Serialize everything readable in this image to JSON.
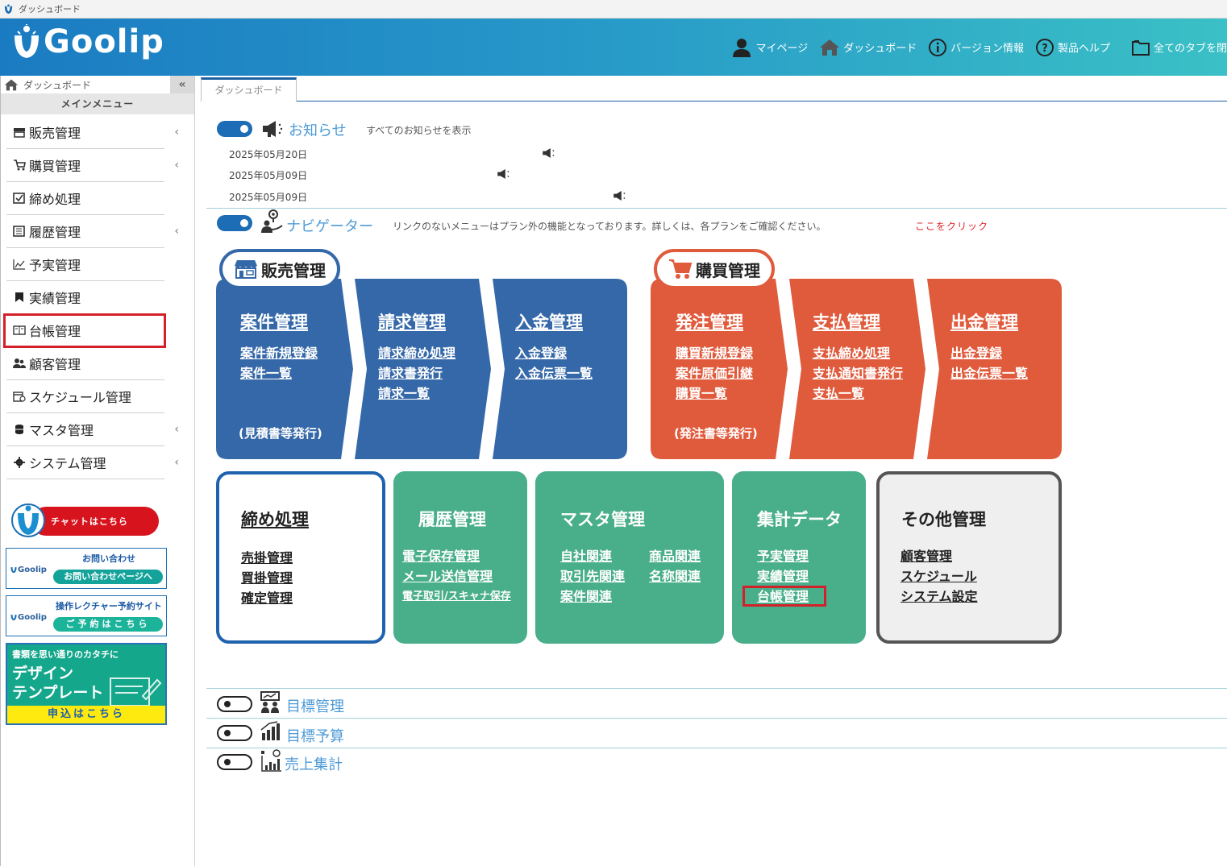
{
  "window": {
    "title": "ダッシュボード"
  },
  "header": {
    "logo_text": "Goolip",
    "nav": {
      "mypage": "マイページ",
      "dashboard": "ダッシュボード",
      "version": "バージョン情報",
      "help": "製品ヘルプ",
      "close_all": "全てのタブを閉"
    }
  },
  "sidebar": {
    "top_label": "ダッシュボード",
    "collapse_label": "«",
    "main_menu": "メインメニュー",
    "items": [
      {
        "label": "販売管理"
      },
      {
        "label": "購買管理"
      },
      {
        "label": "締め処理"
      },
      {
        "label": "履歴管理"
      },
      {
        "label": "予実管理"
      },
      {
        "label": "実績管理"
      },
      {
        "label": "台帳管理"
      },
      {
        "label": "顧客管理"
      },
      {
        "label": "スケジュール管理"
      },
      {
        "label": "マスタ管理"
      },
      {
        "label": "システム管理"
      }
    ],
    "chevron": "‹",
    "chat_label": "チャットはこちら",
    "inquiry": {
      "title": "お問い合わせ",
      "button": "お問い合わせページへ",
      "brand": "Goolip"
    },
    "lecture": {
      "title": "操作レクチャー予約サイト",
      "button": "ご予約はこちら",
      "brand": "Goolip"
    },
    "template": {
      "small": "書類を思い通りのカタチに",
      "line1": "デザイン",
      "line2": "テンプレート",
      "apply": "申込はこちら"
    }
  },
  "tabs": {
    "active": "ダッシュボード"
  },
  "notice": {
    "title": "お知らせ",
    "show_all": "すべてのお知らせを表示",
    "items": [
      {
        "date": "2025年05月20日"
      },
      {
        "date": "2025年05月09日"
      },
      {
        "date": "2025年05月09日"
      }
    ]
  },
  "navigator": {
    "title": "ナビゲーター",
    "desc": "リンクのないメニューはプラン外の機能となっております。詳しくは、各プランをご確認ください。",
    "click_here": "ここをクリック",
    "sales": {
      "badge": "販売管理",
      "cards": [
        {
          "title": "案件管理",
          "links": [
            "案件新規登録",
            "案件一覧"
          ],
          "note": "(見積書等発行)"
        },
        {
          "title": "請求管理",
          "links": [
            "請求締め処理",
            "請求書発行",
            "請求一覧"
          ]
        },
        {
          "title": "入金管理",
          "links": [
            "入金登録",
            "入金伝票一覧"
          ]
        }
      ]
    },
    "purchase": {
      "badge": "購買管理",
      "cards": [
        {
          "title": "発注管理",
          "links": [
            "購買新規登録",
            "案件原価引継",
            "購買一覧"
          ],
          "note": "(発注書等発行)"
        },
        {
          "title": "支払管理",
          "links": [
            "支払締め処理",
            "支払通知書発行",
            "支払一覧"
          ]
        },
        {
          "title": "出金管理",
          "links": [
            "出金登録",
            "出金伝票一覧"
          ]
        }
      ]
    },
    "closing": {
      "title": "締め処理",
      "links": [
        "売掛管理",
        "買掛管理",
        "確定管理"
      ]
    },
    "history": {
      "title": "履歴管理",
      "links": [
        "電子保存管理",
        "メール送信管理",
        "電子取引/スキャナ保存"
      ]
    },
    "master": {
      "title": "マスタ管理",
      "col1": [
        "自社関連",
        "取引先関連",
        "案件関連"
      ],
      "col2": [
        "商品関連",
        "名称関連"
      ]
    },
    "aggregate": {
      "title": "集計データ",
      "links": [
        "予実管理",
        "実績管理",
        "台帳管理"
      ]
    },
    "other": {
      "title": "その他管理",
      "links": [
        "顧客管理",
        "スケジュール",
        "システム設定"
      ]
    }
  },
  "bottom_sections": [
    {
      "title": "目標管理"
    },
    {
      "title": "目標予算"
    },
    {
      "title": "売上集計"
    }
  ],
  "colors": {
    "blue": "#3568a8",
    "red": "#e05a3c",
    "green": "#49ae8a",
    "highlight": "#d4202a"
  }
}
